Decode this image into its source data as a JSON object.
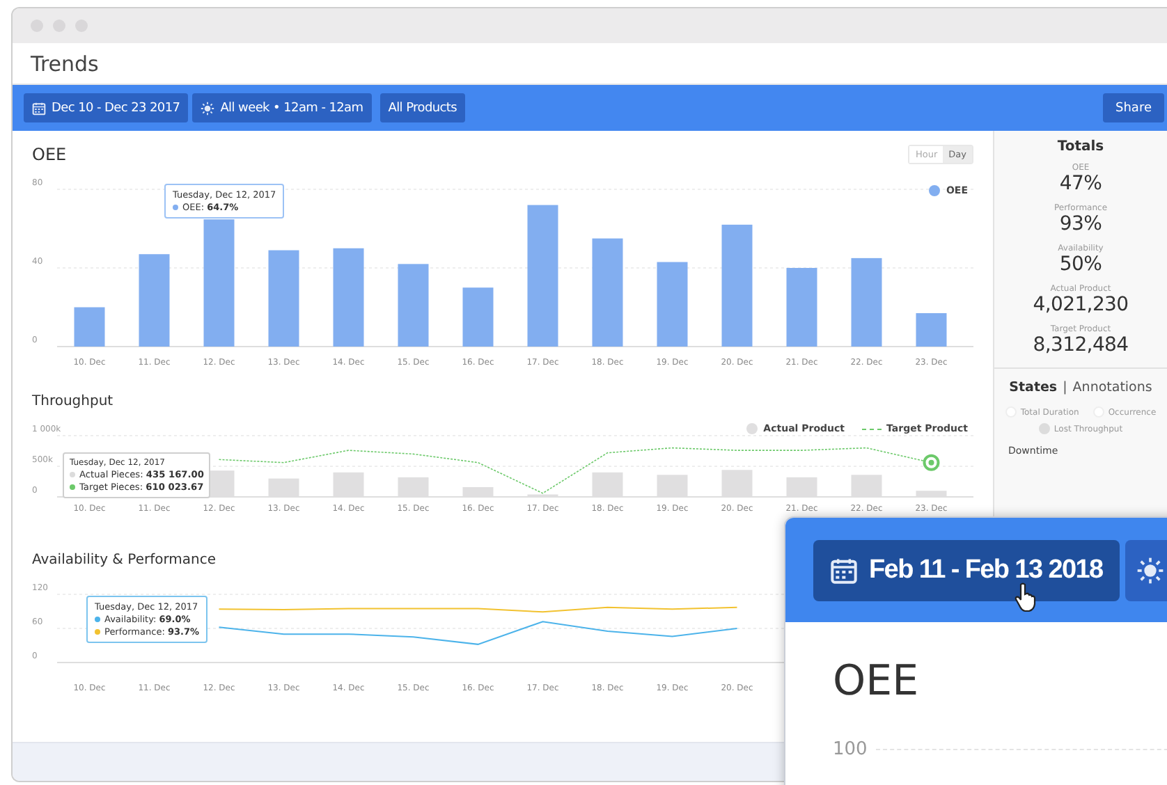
{
  "window": {
    "title": "Trends"
  },
  "toolbar": {
    "filters": [
      {
        "label": "Dec 10 - Dec 23 2017",
        "kind": "date"
      },
      {
        "label": "All week • 12am - 12am",
        "kind": "time"
      },
      {
        "label": "All Products",
        "kind": "plain"
      }
    ],
    "share": "Share"
  },
  "oee": {
    "title": "OEE",
    "granularity": [
      {
        "label": "Hour",
        "selected": false
      },
      {
        "label": "Day",
        "selected": true
      }
    ],
    "tooltip": {
      "date": "Tuesday, Dec 12, 2017",
      "rows": [
        {
          "label": "OEE:",
          "value": "64.7%",
          "color": "#82aef0"
        }
      ]
    },
    "chart_data": {
      "type": "bar",
      "categories": [
        "10. Dec",
        "11. Dec",
        "12. Dec",
        "13. Dec",
        "14. Dec",
        "15. Dec",
        "16. Dec",
        "17. Dec",
        "18. Dec",
        "19. Dec",
        "20. Dec",
        "21. Dec",
        "22. Dec",
        "23. Dec"
      ],
      "series": [
        {
          "name": "OEE",
          "color": "#82aef0",
          "values": [
            20,
            47,
            64.7,
            49,
            50,
            42,
            30,
            72,
            55,
            43,
            62,
            40,
            45,
            17
          ]
        }
      ],
      "ylim": [
        0,
        80
      ],
      "yticks": [
        0,
        40,
        80
      ]
    }
  },
  "throughput": {
    "title": "Throughput",
    "tooltip": {
      "date": "Tuesday, Dec 12, 2017",
      "rows": [
        {
          "label": "Actual Pieces:",
          "value": "435 167.00",
          "color": "#dcdcdc"
        },
        {
          "label": "Target Pieces:",
          "value": "610 023.67",
          "color": "#6cc96a"
        }
      ]
    },
    "chart_data": {
      "type": "bar",
      "categories": [
        "10. Dec",
        "11. Dec",
        "12. Dec",
        "13. Dec",
        "14. Dec",
        "15. Dec",
        "16. Dec",
        "17. Dec",
        "18. Dec",
        "19. Dec",
        "20. Dec",
        "21. Dec",
        "22. Dec",
        "23. Dec"
      ],
      "series": [
        {
          "name": "Actual Product",
          "color": "#e0dfe0",
          "values": [
            null,
            null,
            430,
            300,
            400,
            320,
            160,
            40,
            400,
            360,
            440,
            320,
            360,
            100
          ]
        },
        {
          "name": "Target Product",
          "type": "line",
          "color": "#6cc96a",
          "line_style": "dashed",
          "values": [
            null,
            null,
            610,
            560,
            760,
            700,
            560,
            60,
            720,
            800,
            760,
            760,
            800,
            560
          ]
        }
      ],
      "ylim": [
        0,
        1000
      ],
      "yticks": [
        {
          "value": 0,
          "label": "0"
        },
        {
          "value": 500,
          "label": "500k"
        },
        {
          "value": 1000,
          "label": "1 000k"
        }
      ]
    }
  },
  "availability": {
    "title": "Availability & Performance",
    "tooltip": {
      "date": "Tuesday, Dec 12, 2017",
      "rows": [
        {
          "label": "Availability:",
          "value": "69.0%",
          "color": "#4cb3ea"
        },
        {
          "label": "Performance:",
          "value": "93.7%",
          "color": "#f2c230"
        }
      ]
    },
    "chart_data": {
      "type": "line",
      "categories": [
        "10. Dec",
        "11. Dec",
        "12. Dec",
        "13. Dec",
        "14. Dec",
        "15. Dec",
        "16. Dec",
        "17. Dec",
        "18. Dec",
        "19. Dec",
        "20. Dec"
      ],
      "series": [
        {
          "color": "#4cb3ea",
          "values": [
            null,
            null,
            62,
            50,
            50,
            45,
            32,
            72,
            55,
            46,
            60
          ]
        },
        {
          "color": "#f2c230",
          "values": [
            null,
            null,
            94,
            93,
            95,
            95,
            95,
            89,
            97,
            94,
            97
          ]
        }
      ],
      "ylim": [
        0,
        120
      ],
      "yticks": [
        0,
        60,
        120
      ]
    }
  },
  "totals": {
    "title": "Totals",
    "stats": [
      {
        "label": "OEE",
        "value": "47%"
      },
      {
        "label": "Performance",
        "value": "93%"
      },
      {
        "label": "Availability",
        "value": "50%"
      },
      {
        "label": "Actual Product",
        "value": "4,021,230"
      },
      {
        "label": "Target Product",
        "value": "8,312,484"
      }
    ]
  },
  "states": {
    "tabs": [
      {
        "label": "States",
        "selected": true
      },
      {
        "label": "Annotations",
        "selected": false
      }
    ],
    "separator": "|",
    "options": [
      {
        "label": "Total Duration",
        "checked": false
      },
      {
        "label": "Occurrence",
        "checked": false
      },
      {
        "label": "Lost Throughput",
        "checked": true
      }
    ],
    "section": "Downtime"
  },
  "zoom_inset": {
    "date_button": "Feb 11 - Feb 13 2018",
    "title": "OEE",
    "ytick": "100"
  }
}
